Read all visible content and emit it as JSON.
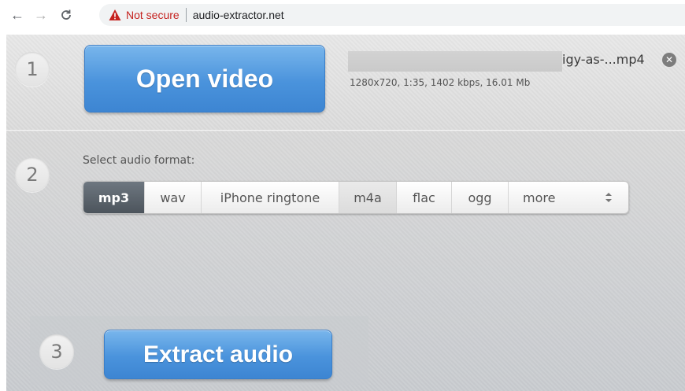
{
  "browser": {
    "security_text": "Not secure",
    "url": "audio-extractor.net",
    "icons": [
      "back-arrow-icon",
      "forward-arrow-icon",
      "reload-icon",
      "warning-icon"
    ]
  },
  "step1": {
    "number": "1",
    "button_label": "Open video",
    "file_name": "igy-as-...mp4",
    "file_meta": "1280x720, 1:35, 1402 kbps, 16.01 Mb"
  },
  "step2": {
    "number": "2",
    "label": "Select audio format:",
    "formats": [
      "mp3",
      "wav",
      "iPhone ringtone",
      "m4a",
      "flac",
      "ogg",
      "more"
    ],
    "selected": "mp3"
  },
  "step3": {
    "number": "3",
    "button_label": "Extract audio"
  },
  "colors": {
    "button_blue": "#4a93dc",
    "not_secure_red": "#c5221f",
    "active_format": "#5a626a"
  }
}
